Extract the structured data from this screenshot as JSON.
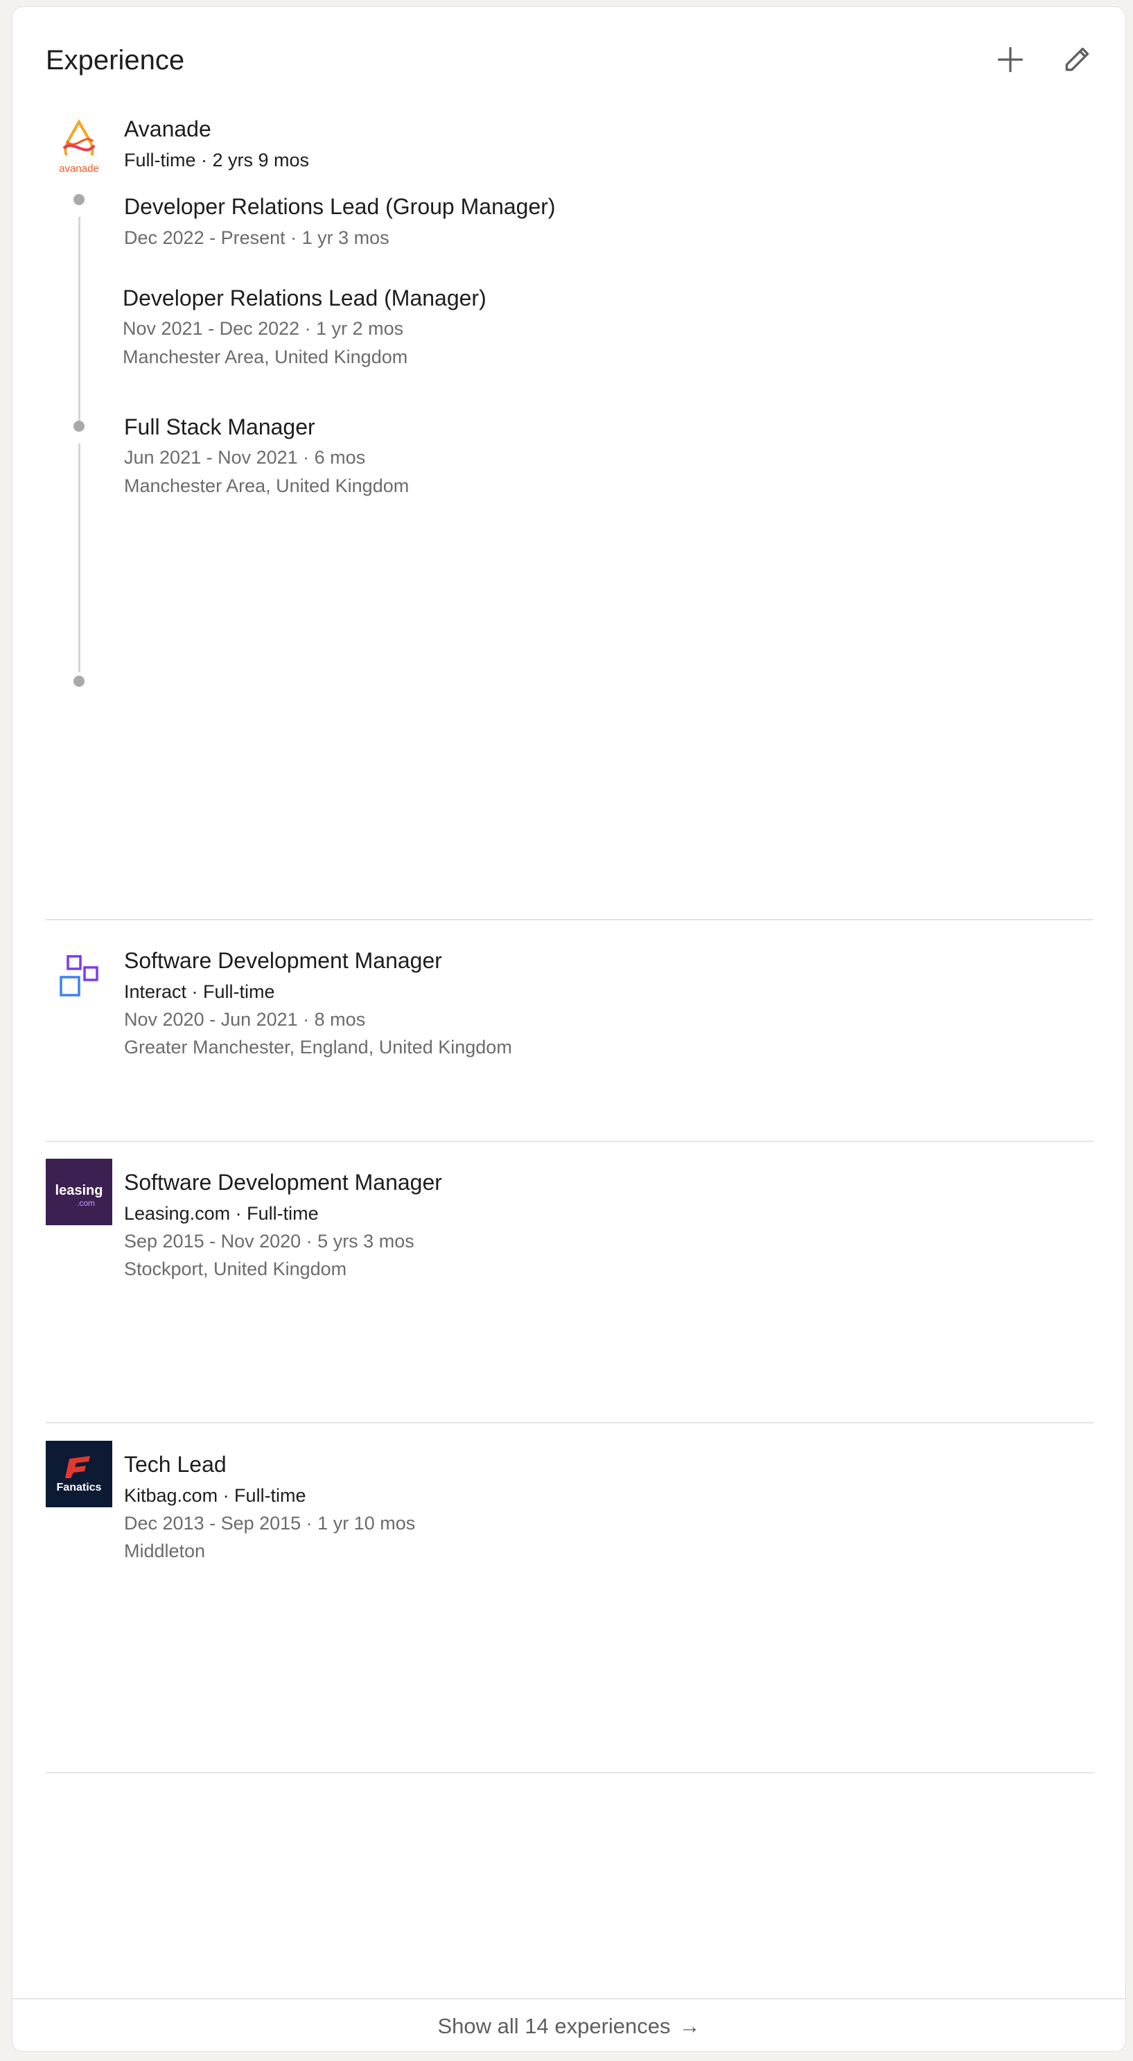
{
  "header": {
    "title": "Experience",
    "add_icon": "plus-icon",
    "edit_icon": "pencil-icon"
  },
  "avanade": {
    "logo_text": "avanade",
    "company": "Avanade",
    "meta": "Full-time · 2 yrs 9 mos",
    "roles": [
      {
        "title": "Developer Relations Lead (Group Manager)",
        "dates": "Dec 2022 - Present · 1 yr 3 mos",
        "location": ""
      },
      {
        "title": "Developer Relations Lead (Manager)",
        "dates": "Nov 2021 - Dec 2022 · 1 yr 2 mos",
        "location": "Manchester Area, United Kingdom"
      },
      {
        "title": "Full Stack Manager",
        "dates": "Jun 2021 - Nov 2021 · 6 mos",
        "location": "Manchester Area, United Kingdom"
      }
    ]
  },
  "positions": [
    {
      "title": "Software Development Manager",
      "company": "Interact · Full-time",
      "dates": "Nov 2020 - Jun 2021 · 8 mos",
      "location": "Greater Manchester, England, United Kingdom"
    },
    {
      "title": "Software Development Manager",
      "company": "Leasing.com · Full-time",
      "dates": "Sep 2015 - Nov 2020 · 5 yrs 3 mos",
      "location": "Stockport, United Kingdom",
      "logo_text": "leasing",
      "logo_subtext": ".com"
    },
    {
      "title": "Tech Lead",
      "company": "Kitbag.com · Full-time",
      "dates": "Dec 2013 - Sep 2015 · 1 yr 10 mos",
      "location": "Middleton",
      "logo_text": "Fanatics"
    }
  ],
  "footer": {
    "label": "Show all 14 experiences",
    "arrow": "→"
  },
  "colors": {
    "leasing_bg": "#3c2052",
    "fanatics_bg": "#0d1a33",
    "fanatics_red": "#e03a2f",
    "avanade_orange": "#f15a22",
    "interact_purple": "#7c3aed",
    "interact_blue": "#3b82f6"
  }
}
